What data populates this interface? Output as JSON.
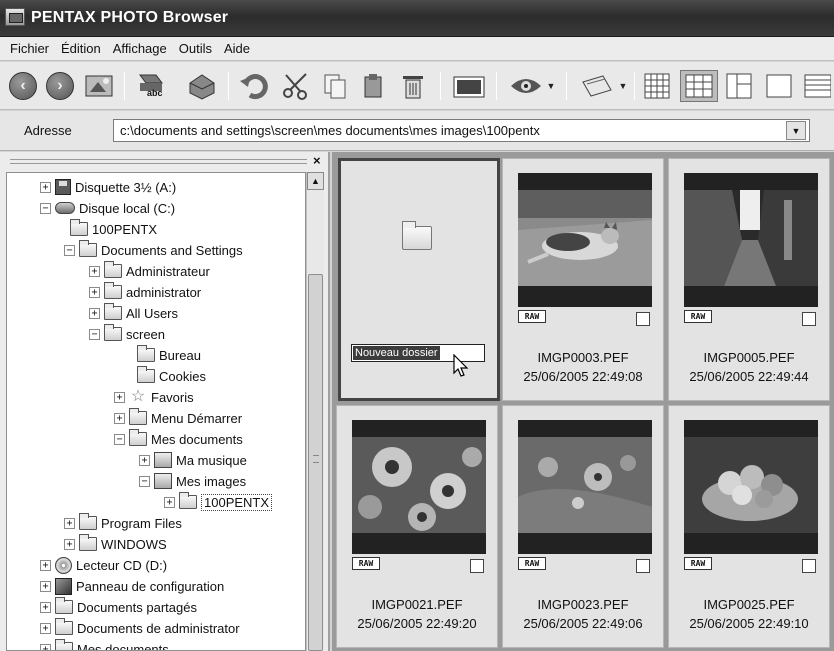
{
  "window": {
    "title": "PENTAX PHOTO Browser"
  },
  "menu": [
    "Fichier",
    "Édition",
    "Affichage",
    "Outils",
    "Aide"
  ],
  "toolbar": {
    "buttons": [
      "back-icon",
      "forward-icon",
      "up-folder-icon",
      "rename-icon",
      "rotate-icon",
      "undo-icon",
      "cut-icon",
      "copy-icon",
      "paste-icon",
      "delete-icon",
      "slideshow-icon",
      "view-icon",
      "filmstrip-icon",
      "thumb-grid-small-icon",
      "thumb-grid-large-icon",
      "preview-layout-icon",
      "single-view-icon",
      "details-icon"
    ],
    "rename_badge": "abc"
  },
  "address": {
    "label": "Adresse",
    "value": "c:\\documents and settings\\screen\\mes documents\\mes images\\100pentx"
  },
  "leftpane": {
    "close_label": "×"
  },
  "tree": [
    {
      "label": "Disquette 3½ (A:)",
      "icon": "floppy-icon",
      "expander": "+"
    },
    {
      "label": "Disque local (C:)",
      "icon": "drive-icon",
      "expander": "−"
    },
    {
      "label": "100PENTX",
      "icon": "folder-icon",
      "expander": ""
    },
    {
      "label": "Documents and Settings",
      "icon": "folder-icon",
      "expander": "−"
    },
    {
      "label": "Administrateur",
      "icon": "folder-icon",
      "expander": "+"
    },
    {
      "label": "administrator",
      "icon": "folder-icon",
      "expander": "+"
    },
    {
      "label": "All Users",
      "icon": "folder-icon",
      "expander": "+"
    },
    {
      "label": "screen",
      "icon": "folder-icon",
      "expander": "−"
    },
    {
      "label": "Bureau",
      "icon": "folder-icon",
      "expander": ""
    },
    {
      "label": "Cookies",
      "icon": "folder-icon",
      "expander": ""
    },
    {
      "label": "Favoris",
      "icon": "star-icon",
      "expander": "+"
    },
    {
      "label": "Menu Démarrer",
      "icon": "folder-icon",
      "expander": "+"
    },
    {
      "label": "Mes documents",
      "icon": "folder-icon",
      "expander": "−"
    },
    {
      "label": "Ma musique",
      "icon": "music-folder-icon",
      "expander": "+"
    },
    {
      "label": "Mes images",
      "icon": "images-folder-icon",
      "expander": "−"
    },
    {
      "label": "100PENTX",
      "icon": "folder-icon",
      "expander": "+",
      "selected": true
    },
    {
      "label": "Program Files",
      "icon": "folder-icon",
      "expander": "+"
    },
    {
      "label": "WINDOWS",
      "icon": "folder-icon",
      "expander": "+"
    },
    {
      "label": "Lecteur CD (D:)",
      "icon": "cd-icon",
      "expander": "+"
    },
    {
      "label": "Panneau de configuration",
      "icon": "control-panel-icon",
      "expander": "+"
    },
    {
      "label": "Documents partagés",
      "icon": "folder-icon",
      "expander": "+"
    },
    {
      "label": "Documents de administrator",
      "icon": "folder-icon",
      "expander": "+"
    },
    {
      "label": "Mes documents",
      "icon": "folder-icon",
      "expander": "+"
    }
  ],
  "thumbnails": [
    {
      "type": "new-folder",
      "rename_value": "Nouveau dossier"
    },
    {
      "name": "IMGP0003.PEF",
      "date": "25/06/2005 22:49:08",
      "badge": "RAW",
      "subject": "cat"
    },
    {
      "name": "IMGP0005.PEF",
      "date": "25/06/2005 22:49:44",
      "badge": "RAW",
      "subject": "alley"
    },
    {
      "name": "IMGP0021.PEF",
      "date": "25/06/2005 22:49:20",
      "badge": "RAW",
      "subject": "flowers"
    },
    {
      "name": "IMGP0023.PEF",
      "date": "25/06/2005 22:49:06",
      "badge": "RAW",
      "subject": "flower-field"
    },
    {
      "name": "IMGP0025.PEF",
      "date": "25/06/2005 22:49:10",
      "badge": "RAW",
      "subject": "fruit-basket"
    }
  ]
}
